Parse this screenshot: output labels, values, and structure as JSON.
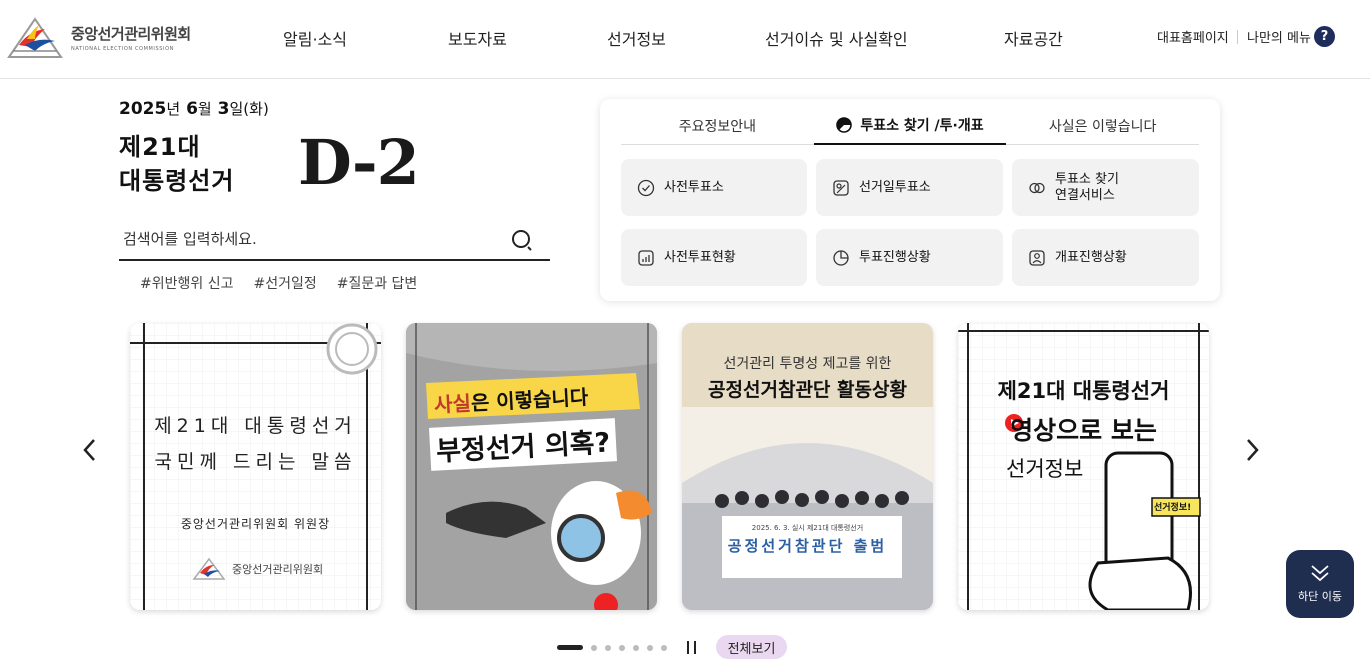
{
  "header": {
    "logo_title": "중앙선거관리위원회",
    "logo_sub": "NATIONAL ELECTION COMMISSION",
    "nav": [
      "알림·소식",
      "보도자료",
      "선거정보",
      "선거이슈 및 사실확인",
      "자료공간"
    ],
    "util_home": "대표홈페이지",
    "util_menu": "나만의 메뉴",
    "help": "?"
  },
  "hero": {
    "year": "2025",
    "year_unit": "년",
    "month": "6",
    "month_unit": "월",
    "day": "3",
    "day_unit": "일",
    "weekday": "(화)",
    "election_line1": "제21대",
    "election_line2": "대통령선거",
    "dday": "D-2"
  },
  "search": {
    "placeholder": "검색어를 입력하세요.",
    "tags": [
      "#위반행위 신고",
      "#선거일정",
      "#질문과 답변"
    ]
  },
  "panel": {
    "tabs": [
      "주요정보안내",
      "투표소 찾기 /투·개표",
      "사실은 이렇습니다"
    ],
    "active_tab": 1,
    "buttons": [
      {
        "label": "사전투표소",
        "icon": "check-circle-icon"
      },
      {
        "label": "선거일투표소",
        "icon": "ballot-icon"
      },
      {
        "label": "투표소 찾기\n연결서비스",
        "icon": "link-icon"
      },
      {
        "label": "사전투표현황",
        "icon": "chart-icon"
      },
      {
        "label": "투표진행상황",
        "icon": "pie-icon"
      },
      {
        "label": "개표진행상황",
        "icon": "person-icon"
      }
    ]
  },
  "cards": [
    {
      "line1": "제21대 대통령선거",
      "line2": "국민께 드리는 말씀",
      "sign": "중앙선거관리위원회 위원장",
      "logo_text": "중앙선거관리위원회"
    },
    {
      "line1": "사실",
      "line1b": "은 이렇습니다",
      "line2": "부정선거 의혹?"
    },
    {
      "line1": "선거관리 투명성 제고를 위한",
      "line2": "공정선거참관단 활동상황",
      "banner_small": "2025. 6. 3. 실시 제21대 대통령선거",
      "banner": "공정선거참관단 출범"
    },
    {
      "line1": "제21대 대통령선거",
      "line2": "영상으로 보는",
      "line3": "선거정보",
      "badge": "선거정보!"
    }
  ],
  "carousel": {
    "view_all": "전체보기",
    "total_dots": 7
  },
  "floating": {
    "label": "하단 이동"
  }
}
